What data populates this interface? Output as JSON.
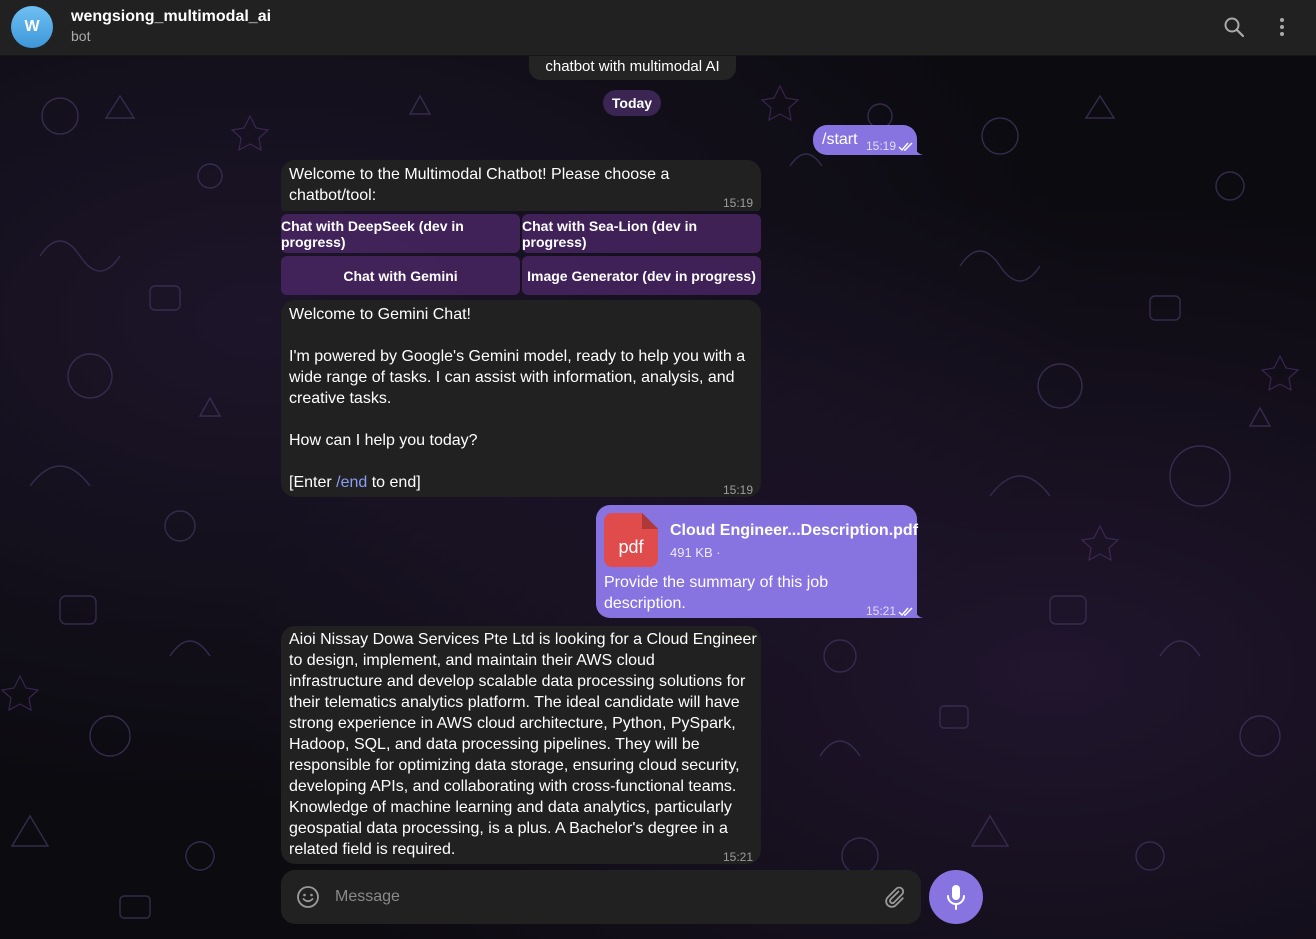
{
  "header": {
    "avatar_letter": "W",
    "title": "wengsiong_multimodal_ai",
    "subtitle": "bot"
  },
  "service_message": "chatbot with multimodal AI",
  "date_separator": "Today",
  "messages": {
    "start": {
      "text": "/start",
      "time": "15:19"
    },
    "welcome": {
      "text_line1": "Welcome to the Multimodal Chatbot! Please choose a",
      "text_line2": "chatbot/tool:",
      "time": "15:19"
    },
    "keyboard": [
      "Chat with DeepSeek (dev in progress)",
      "Chat with Sea-Lion (dev in progress)",
      "Chat with Gemini",
      "Image Generator (dev in progress)"
    ],
    "gemini": {
      "line1": "Welcome to Gemini Chat!",
      "line2": "I'm powered by Google's Gemini model, ready to help you with a",
      "line3": "wide range of tasks. I can assist with information, analysis, and",
      "line4": "creative tasks.",
      "line5": "How can I help you today?",
      "line6_pre": "[Enter ",
      "line6_cmd": "/end",
      "line6_post": " to end]",
      "time": "15:19"
    },
    "file": {
      "icon_label": "pdf",
      "filename": "Cloud Engineer...Description.pdf",
      "size": "491 KB ·",
      "caption_line1": "Provide the summary of this job",
      "caption_line2": "description.",
      "time": "15:21"
    },
    "summary": {
      "lines": [
        "Aioi Nissay Dowa Services Pte Ltd is looking for a Cloud Engineer",
        "to design, implement, and maintain their AWS cloud",
        "infrastructure and develop scalable data processing solutions for",
        "their telematics analytics platform. The ideal candidate will have",
        "strong experience in AWS cloud architecture, Python, PySpark,",
        "Hadoop, SQL, and data processing pipelines. They will be",
        "responsible for optimizing data storage, ensuring cloud security,",
        "developing APIs, and collaborating with cross-functional teams.",
        "Knowledge of machine learning and data analytics, particularly",
        "geospatial data processing, is a plus. A Bachelor's degree in a",
        "related field is required."
      ],
      "time": "15:21"
    }
  },
  "composer": {
    "placeholder": "Message"
  },
  "colors": {
    "accent": "#8774e1",
    "bubble_in": "#212121",
    "header": "#212121",
    "keyboard_button": "#50286e",
    "pdf": "#e04b4b"
  },
  "icons": {
    "search": "search-icon",
    "more": "more-vertical-icon",
    "emoji": "emoji-icon",
    "attach": "paperclip-icon",
    "mic": "microphone-icon",
    "read": "double-check-icon"
  }
}
